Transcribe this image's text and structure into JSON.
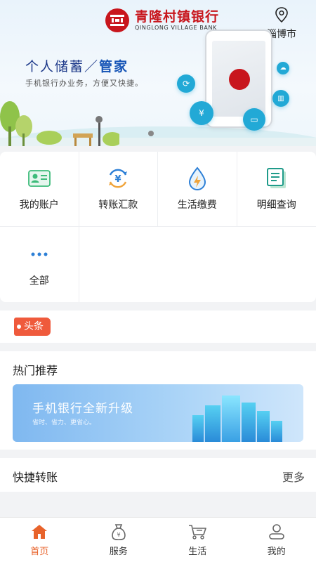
{
  "header": {
    "bank_name_cn": "青隆村镇银行",
    "bank_name_en": "QINGLONG VILLAGE BANK",
    "city": "淄博市",
    "slogan_prefix": "个人储蓄／",
    "slogan_highlight": "管家",
    "sub_slogan": "手机银行办业务，方便又快捷。"
  },
  "menu": {
    "items": [
      {
        "label": "我的账户",
        "icon": "account-card-icon"
      },
      {
        "label": "转账汇款",
        "icon": "transfer-yuan-icon"
      },
      {
        "label": "生活缴费",
        "icon": "water-bolt-icon"
      },
      {
        "label": "明细查询",
        "icon": "document-list-icon"
      },
      {
        "label": "全部",
        "icon": "more-dots-icon"
      }
    ]
  },
  "headline": {
    "tag": "头条"
  },
  "hot": {
    "title": "热门推荐",
    "banner_title": "手机银行全新升级",
    "banner_sub": "省时、省力、更省心。"
  },
  "quick_transfer": {
    "title": "快捷转账",
    "more": "更多"
  },
  "tabbar": {
    "tabs": [
      {
        "label": "首页",
        "icon": "home-icon",
        "active": true
      },
      {
        "label": "服务",
        "icon": "service-bag-icon",
        "active": false
      },
      {
        "label": "生活",
        "icon": "shopping-cart-icon",
        "active": false
      },
      {
        "label": "我的",
        "icon": "user-icon",
        "active": false
      }
    ]
  },
  "colors": {
    "brand": "#c8161d",
    "accent": "#e8632b",
    "teal": "#22a9d6",
    "icon_green": "#3dbb7a",
    "icon_blue": "#2c7fd6"
  }
}
